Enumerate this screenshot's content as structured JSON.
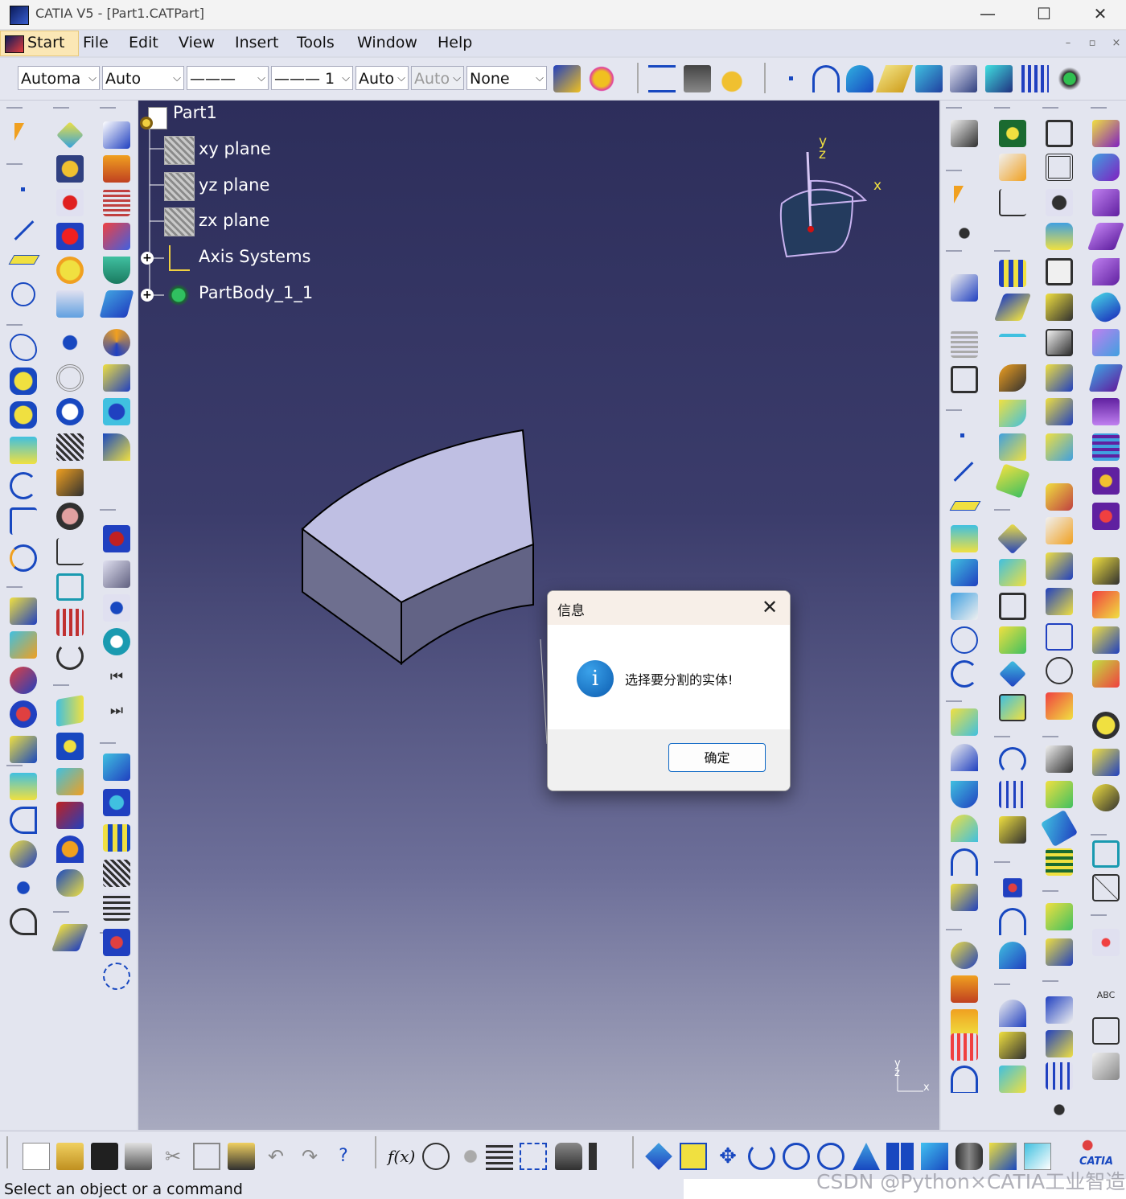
{
  "window": {
    "title": "CATIA V5 - [Part1.CATPart]",
    "minimize": "—",
    "maximize": "☐",
    "close": "✕"
  },
  "menubar": {
    "items": [
      "Start",
      "File",
      "Edit",
      "View",
      "Insert",
      "Tools",
      "Window",
      "Help"
    ],
    "mdi_min": "–",
    "mdi_restore": "▫",
    "mdi_close": "×"
  },
  "toolbar": {
    "combos": [
      {
        "value": "Automa",
        "disabled": false
      },
      {
        "value": "Auto",
        "disabled": false
      },
      {
        "value": "———",
        "disabled": false
      },
      {
        "value": "——— 1",
        "disabled": false
      },
      {
        "value": "Auto",
        "disabled": false
      },
      {
        "value": "Auto",
        "disabled": true
      },
      {
        "value": "None",
        "disabled": false
      }
    ]
  },
  "tree": {
    "root": "Part1",
    "items": [
      {
        "label": "xy plane",
        "type": "plane"
      },
      {
        "label": "yz plane",
        "type": "plane"
      },
      {
        "label": "zx plane",
        "type": "plane"
      },
      {
        "label": "Axis Systems",
        "type": "axis",
        "expandable": true
      },
      {
        "label": "PartBody_1_1",
        "type": "body",
        "expandable": true
      }
    ]
  },
  "compass": {
    "x": "x",
    "y": "y",
    "z": "z"
  },
  "axis_triad": {
    "x": "x",
    "y": "y",
    "z": "z"
  },
  "dialog": {
    "title": "信息",
    "message": "选择要分割的实体!",
    "ok_label": "确定",
    "icon": "info-icon"
  },
  "statusbar": {
    "text": "Select an object or a command"
  },
  "watermark": "CSDN @Python×CATIA工业智造",
  "colors": {
    "viewport_top": "#2d2e5b",
    "viewport_bottom": "#a8aabf",
    "part_top": "#bfbfe3",
    "part_side": "#6b6c8e",
    "accent": "#0c67c5"
  }
}
